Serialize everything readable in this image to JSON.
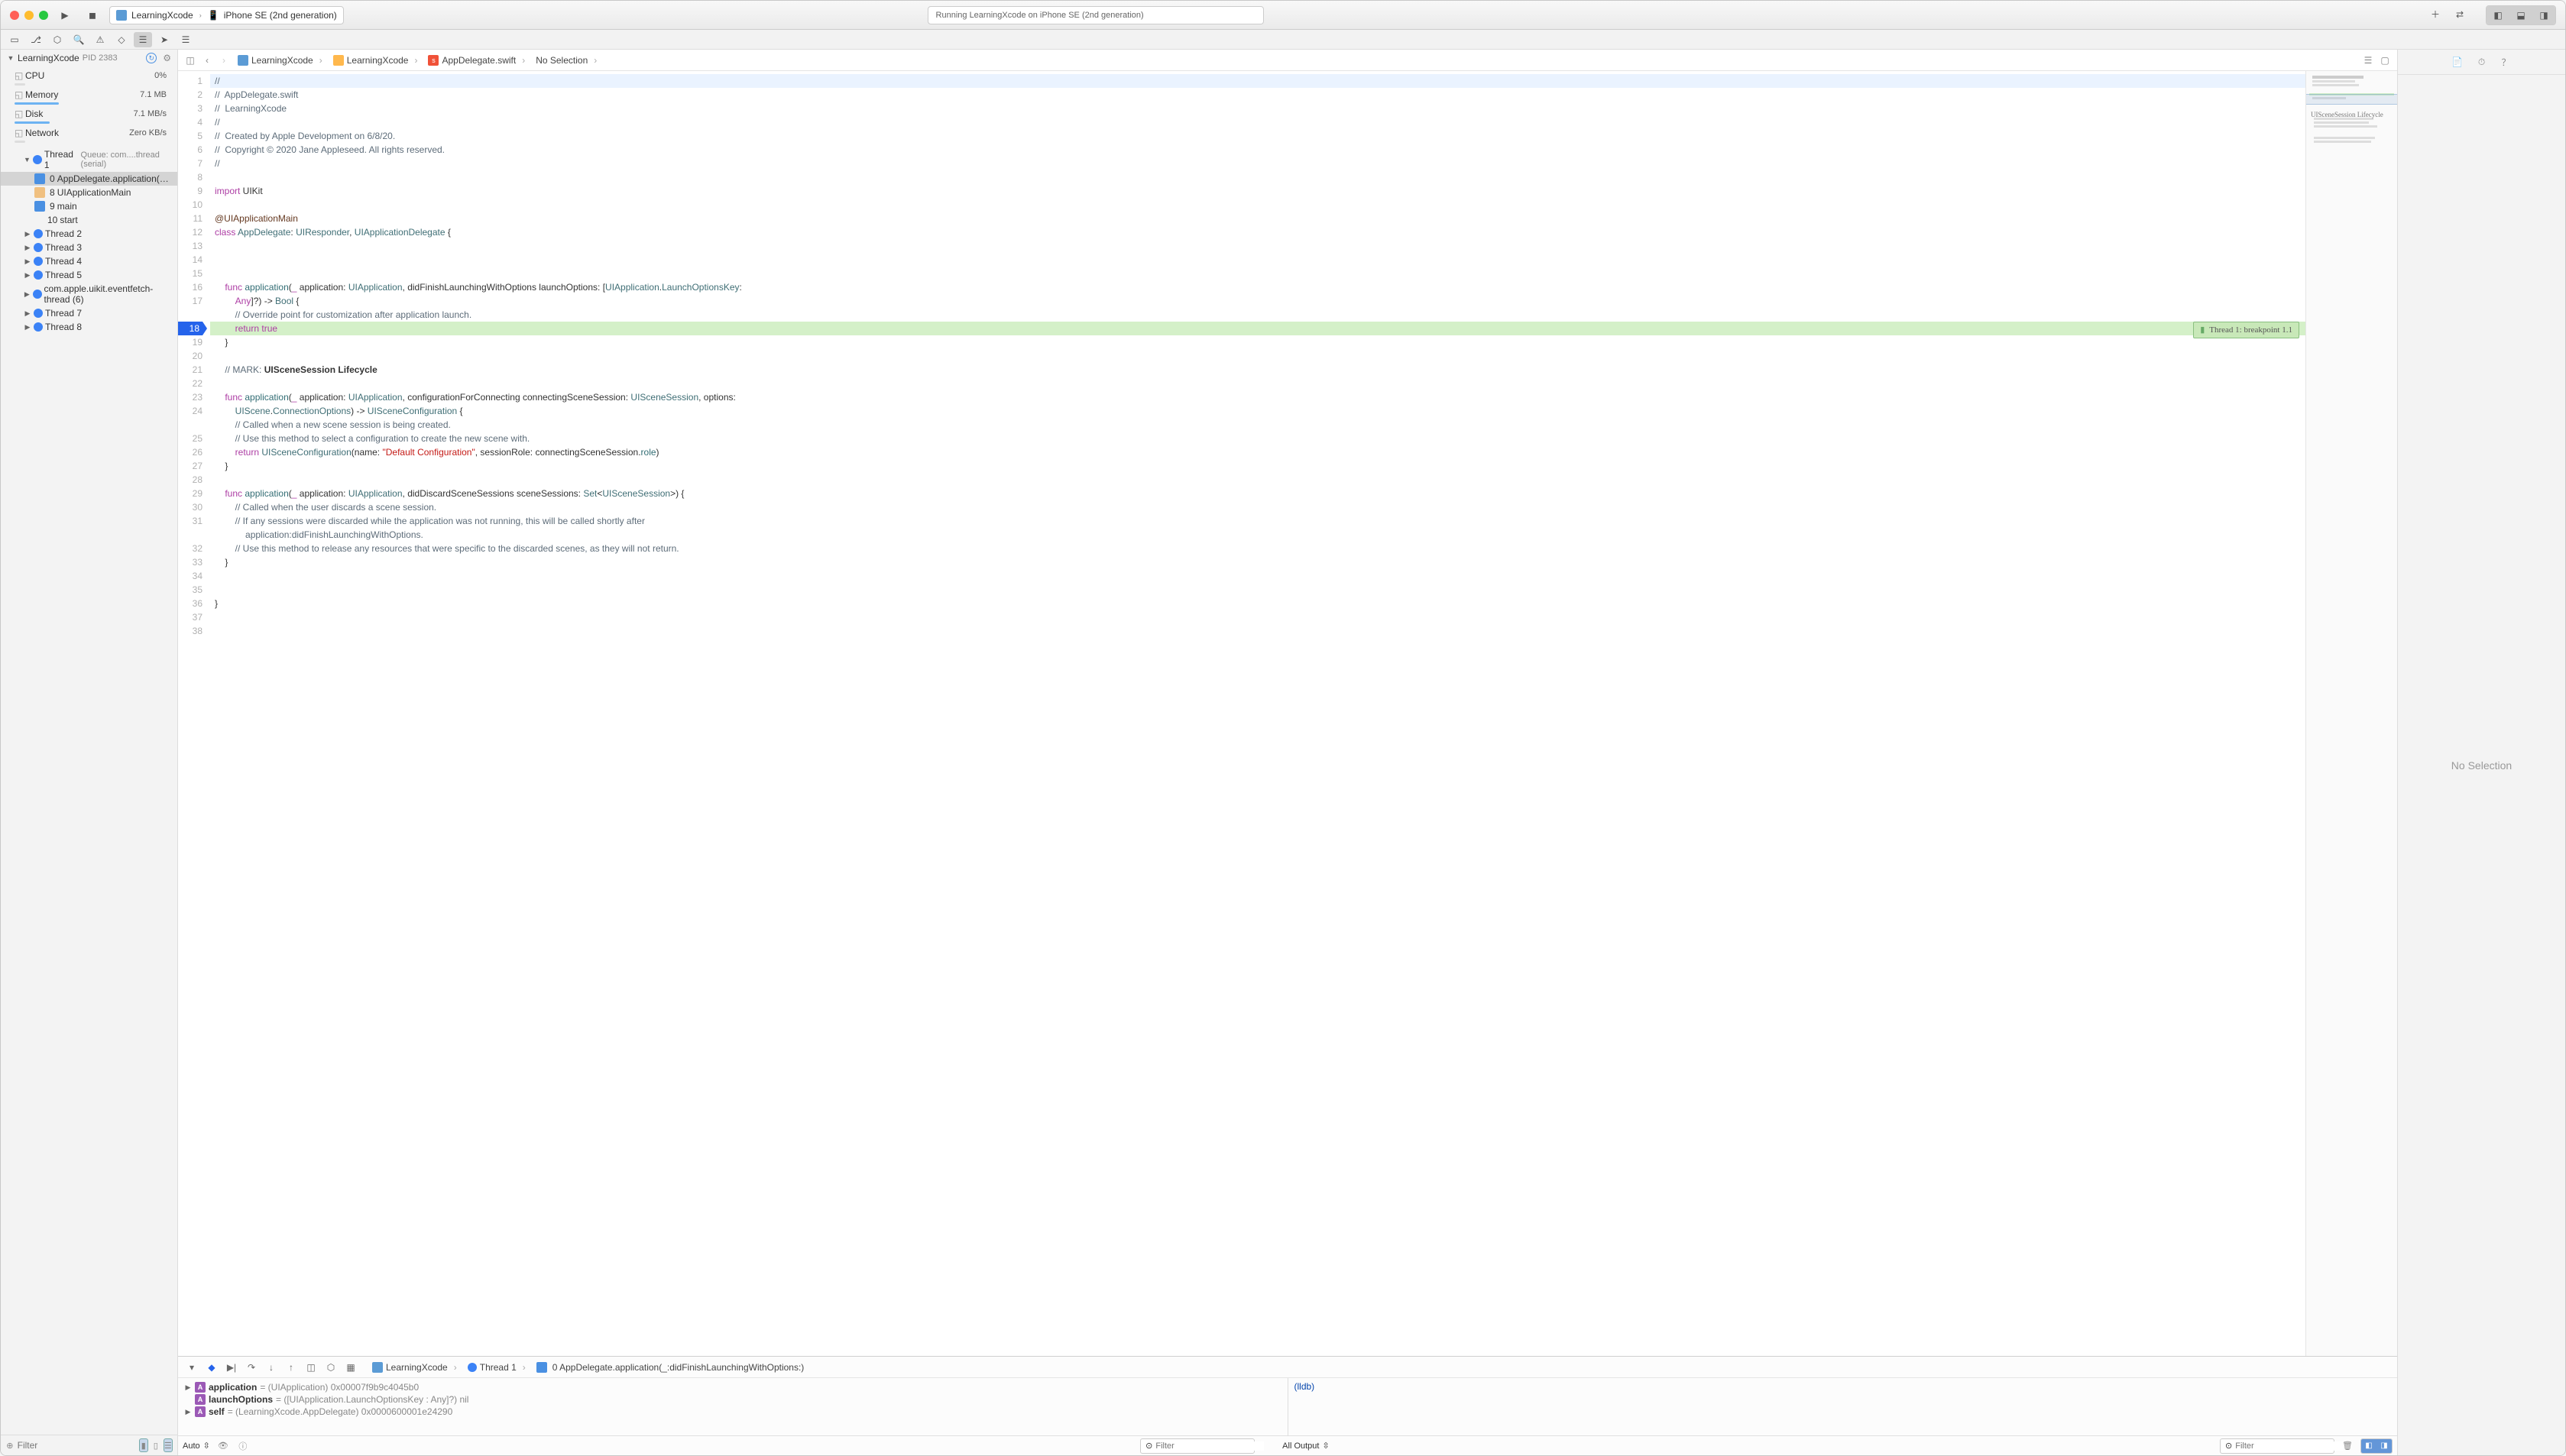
{
  "toolbar": {
    "scheme_project": "LearningXcode",
    "scheme_device": "iPhone SE (2nd generation)",
    "status_text": "Running LearningXcode on iPhone SE (2nd generation)"
  },
  "navigator": {
    "process_name": "LearningXcode",
    "pid_label": "PID 2383",
    "gauges": [
      {
        "label": "CPU",
        "value": "0%"
      },
      {
        "label": "Memory",
        "value": "7.1 MB"
      },
      {
        "label": "Disk",
        "value": "7.1 MB/s"
      },
      {
        "label": "Network",
        "value": "Zero KB/s"
      }
    ],
    "thread1": {
      "label": "Thread 1",
      "queue": "Queue: com....thread (serial)",
      "frames": [
        {
          "idx": "0",
          "label": "AppDelegate.application(_:didFin...",
          "sel": true,
          "icon": "user"
        },
        {
          "idx": "8",
          "label": "UIApplicationMain",
          "icon": "sys"
        },
        {
          "idx": "9",
          "label": "main",
          "icon": "user"
        },
        {
          "idx": "10",
          "label": "start",
          "icon": "sys-plain"
        }
      ]
    },
    "threads_collapsed": [
      {
        "label": "Thread 2"
      },
      {
        "label": "Thread 3"
      },
      {
        "label": "Thread 4"
      },
      {
        "label": "Thread 5"
      },
      {
        "label": "com.apple.uikit.eventfetch-thread (6)"
      },
      {
        "label": "Thread 7"
      },
      {
        "label": "Thread 8"
      }
    ],
    "filter_placeholder": "Filter"
  },
  "jumpbar": {
    "seg1": "LearningXcode",
    "seg2": "LearningXcode",
    "seg3": "AppDelegate.swift",
    "seg4": "No Selection"
  },
  "minimap_mark": "UISceneSession Lifecycle",
  "breakpoint_annotation": "Thread 1: breakpoint 1.1",
  "code": {
    "lines": [
      {
        "n": 1,
        "hl": "current",
        "html": "<span class='cmt'>//</span>"
      },
      {
        "n": 2,
        "html": "<span class='cmt'>//  AppDelegate.swift</span>"
      },
      {
        "n": 3,
        "html": "<span class='cmt'>//  LearningXcode</span>"
      },
      {
        "n": 4,
        "html": "<span class='cmt'>//</span>"
      },
      {
        "n": 5,
        "html": "<span class='cmt'>//  Created by Apple Development on 6/8/20.</span>"
      },
      {
        "n": 6,
        "html": "<span class='cmt'>//  Copyright © 2020 Jane Appleseed. All rights reserved.</span>"
      },
      {
        "n": 7,
        "html": "<span class='cmt'>//</span>"
      },
      {
        "n": 8,
        "html": ""
      },
      {
        "n": 9,
        "html": "<span class='kw'>import</span> UIKit"
      },
      {
        "n": 10,
        "html": ""
      },
      {
        "n": 11,
        "html": "<span class='attr'>@UIApplicationMain</span>"
      },
      {
        "n": 12,
        "html": "<span class='kw'>class</span> <span class='type'>AppDelegate</span>: <span class='type'>UIResponder</span>, <span class='type'>UIApplicationDelegate</span> {"
      },
      {
        "n": 13,
        "html": ""
      },
      {
        "n": 14,
        "html": ""
      },
      {
        "n": 15,
        "html": ""
      },
      {
        "n": 16,
        "html": "    <span class='kw'>func</span> <span class='func'>application</span>(<span class='kw'>_</span> application: <span class='type'>UIApplication</span>, didFinishLaunchingWithOptions launchOptions: [<span class='type'>UIApplication</span>.<span class='type'>LaunchOptionsKey</span>:"
      },
      {
        "n": 17,
        "html": "        <span class='kw'>Any</span>]?) -> <span class='type'>Bool</span> {<br>        <span class='cmt'>// Override point for customization after application launch.</span>",
        "split": true
      },
      {
        "n": 18,
        "bp": true,
        "hl": "exec",
        "html": "        <span class='kw'>return</span> <span class='kw'>true</span>",
        "annot": true
      },
      {
        "n": 19,
        "html": "    }"
      },
      {
        "n": 20,
        "html": ""
      },
      {
        "n": 21,
        "html": "    <span class='cmt'>// MARK:</span> <span style='font-weight:600'>UISceneSession Lifecycle</span>"
      },
      {
        "n": 22,
        "html": ""
      },
      {
        "n": 23,
        "html": "    <span class='kw'>func</span> <span class='func'>application</span>(<span class='kw'>_</span> application: <span class='type'>UIApplication</span>, configurationForConnecting connectingSceneSession: <span class='type'>UISceneSession</span>, options:"
      },
      {
        "n": 24,
        "html": "        <span class='type'>UIScene</span>.<span class='type'>ConnectionOptions</span>) -> <span class='type'>UISceneConfiguration</span> {<br>        <span class='cmt'>// Called when a new scene session is being created.</span>",
        "split": true
      },
      {
        "n": 25,
        "html": "        <span class='cmt'>// Use this method to select a configuration to create the new scene with.</span>"
      },
      {
        "n": 26,
        "html": "        <span class='kw'>return</span> <span class='type'>UISceneConfiguration</span>(name: <span class='str'>\"Default Configuration\"</span>, sessionRole: connectingSceneSession.<span class='func'>role</span>)"
      },
      {
        "n": 27,
        "html": "    }"
      },
      {
        "n": 28,
        "html": ""
      },
      {
        "n": 29,
        "html": "    <span class='kw'>func</span> <span class='func'>application</span>(<span class='kw'>_</span> application: <span class='type'>UIApplication</span>, didDiscardSceneSessions sceneSessions: <span class='type'>Set</span>&lt;<span class='type'>UISceneSession</span>&gt;) {"
      },
      {
        "n": 30,
        "html": "        <span class='cmt'>// Called when the user discards a scene session.</span>"
      },
      {
        "n": 31,
        "html": "        <span class='cmt'>// If any sessions were discarded while the application was not running, this will be called shortly after</span><br>            <span class='cmt'>application:didFinishLaunchingWithOptions.</span>",
        "split": true
      },
      {
        "n": 32,
        "html": "        <span class='cmt'>// Use this method to release any resources that were specific to the discarded scenes, as they will not return.</span>"
      },
      {
        "n": 33,
        "html": "    }"
      },
      {
        "n": 34,
        "html": ""
      },
      {
        "n": 35,
        "html": ""
      },
      {
        "n": 36,
        "html": "}"
      },
      {
        "n": 37,
        "html": ""
      },
      {
        "n": 38,
        "html": ""
      }
    ]
  },
  "debug_bar": {
    "crumb_project": "LearningXcode",
    "crumb_thread": "Thread 1",
    "crumb_frame": "0 AppDelegate.application(_:didFinishLaunchingWithOptions:)"
  },
  "variables": [
    {
      "name": "application",
      "val": "= (UIApplication) 0x00007f9b9c4045b0",
      "disc": true
    },
    {
      "name": "launchOptions",
      "val": "= ([UIApplication.LaunchOptionsKey : Any]?) nil",
      "disc": false
    },
    {
      "name": "self",
      "val": "= (LearningXcode.AppDelegate) 0x0000600001e24290",
      "disc": true
    }
  ],
  "console_prompt": "(lldb)",
  "debug_footer": {
    "auto_label": "Auto",
    "filter_placeholder": "Filter",
    "output_label": "All Output",
    "filter2_placeholder": "Filter"
  },
  "inspector_placeholder": "No Selection"
}
